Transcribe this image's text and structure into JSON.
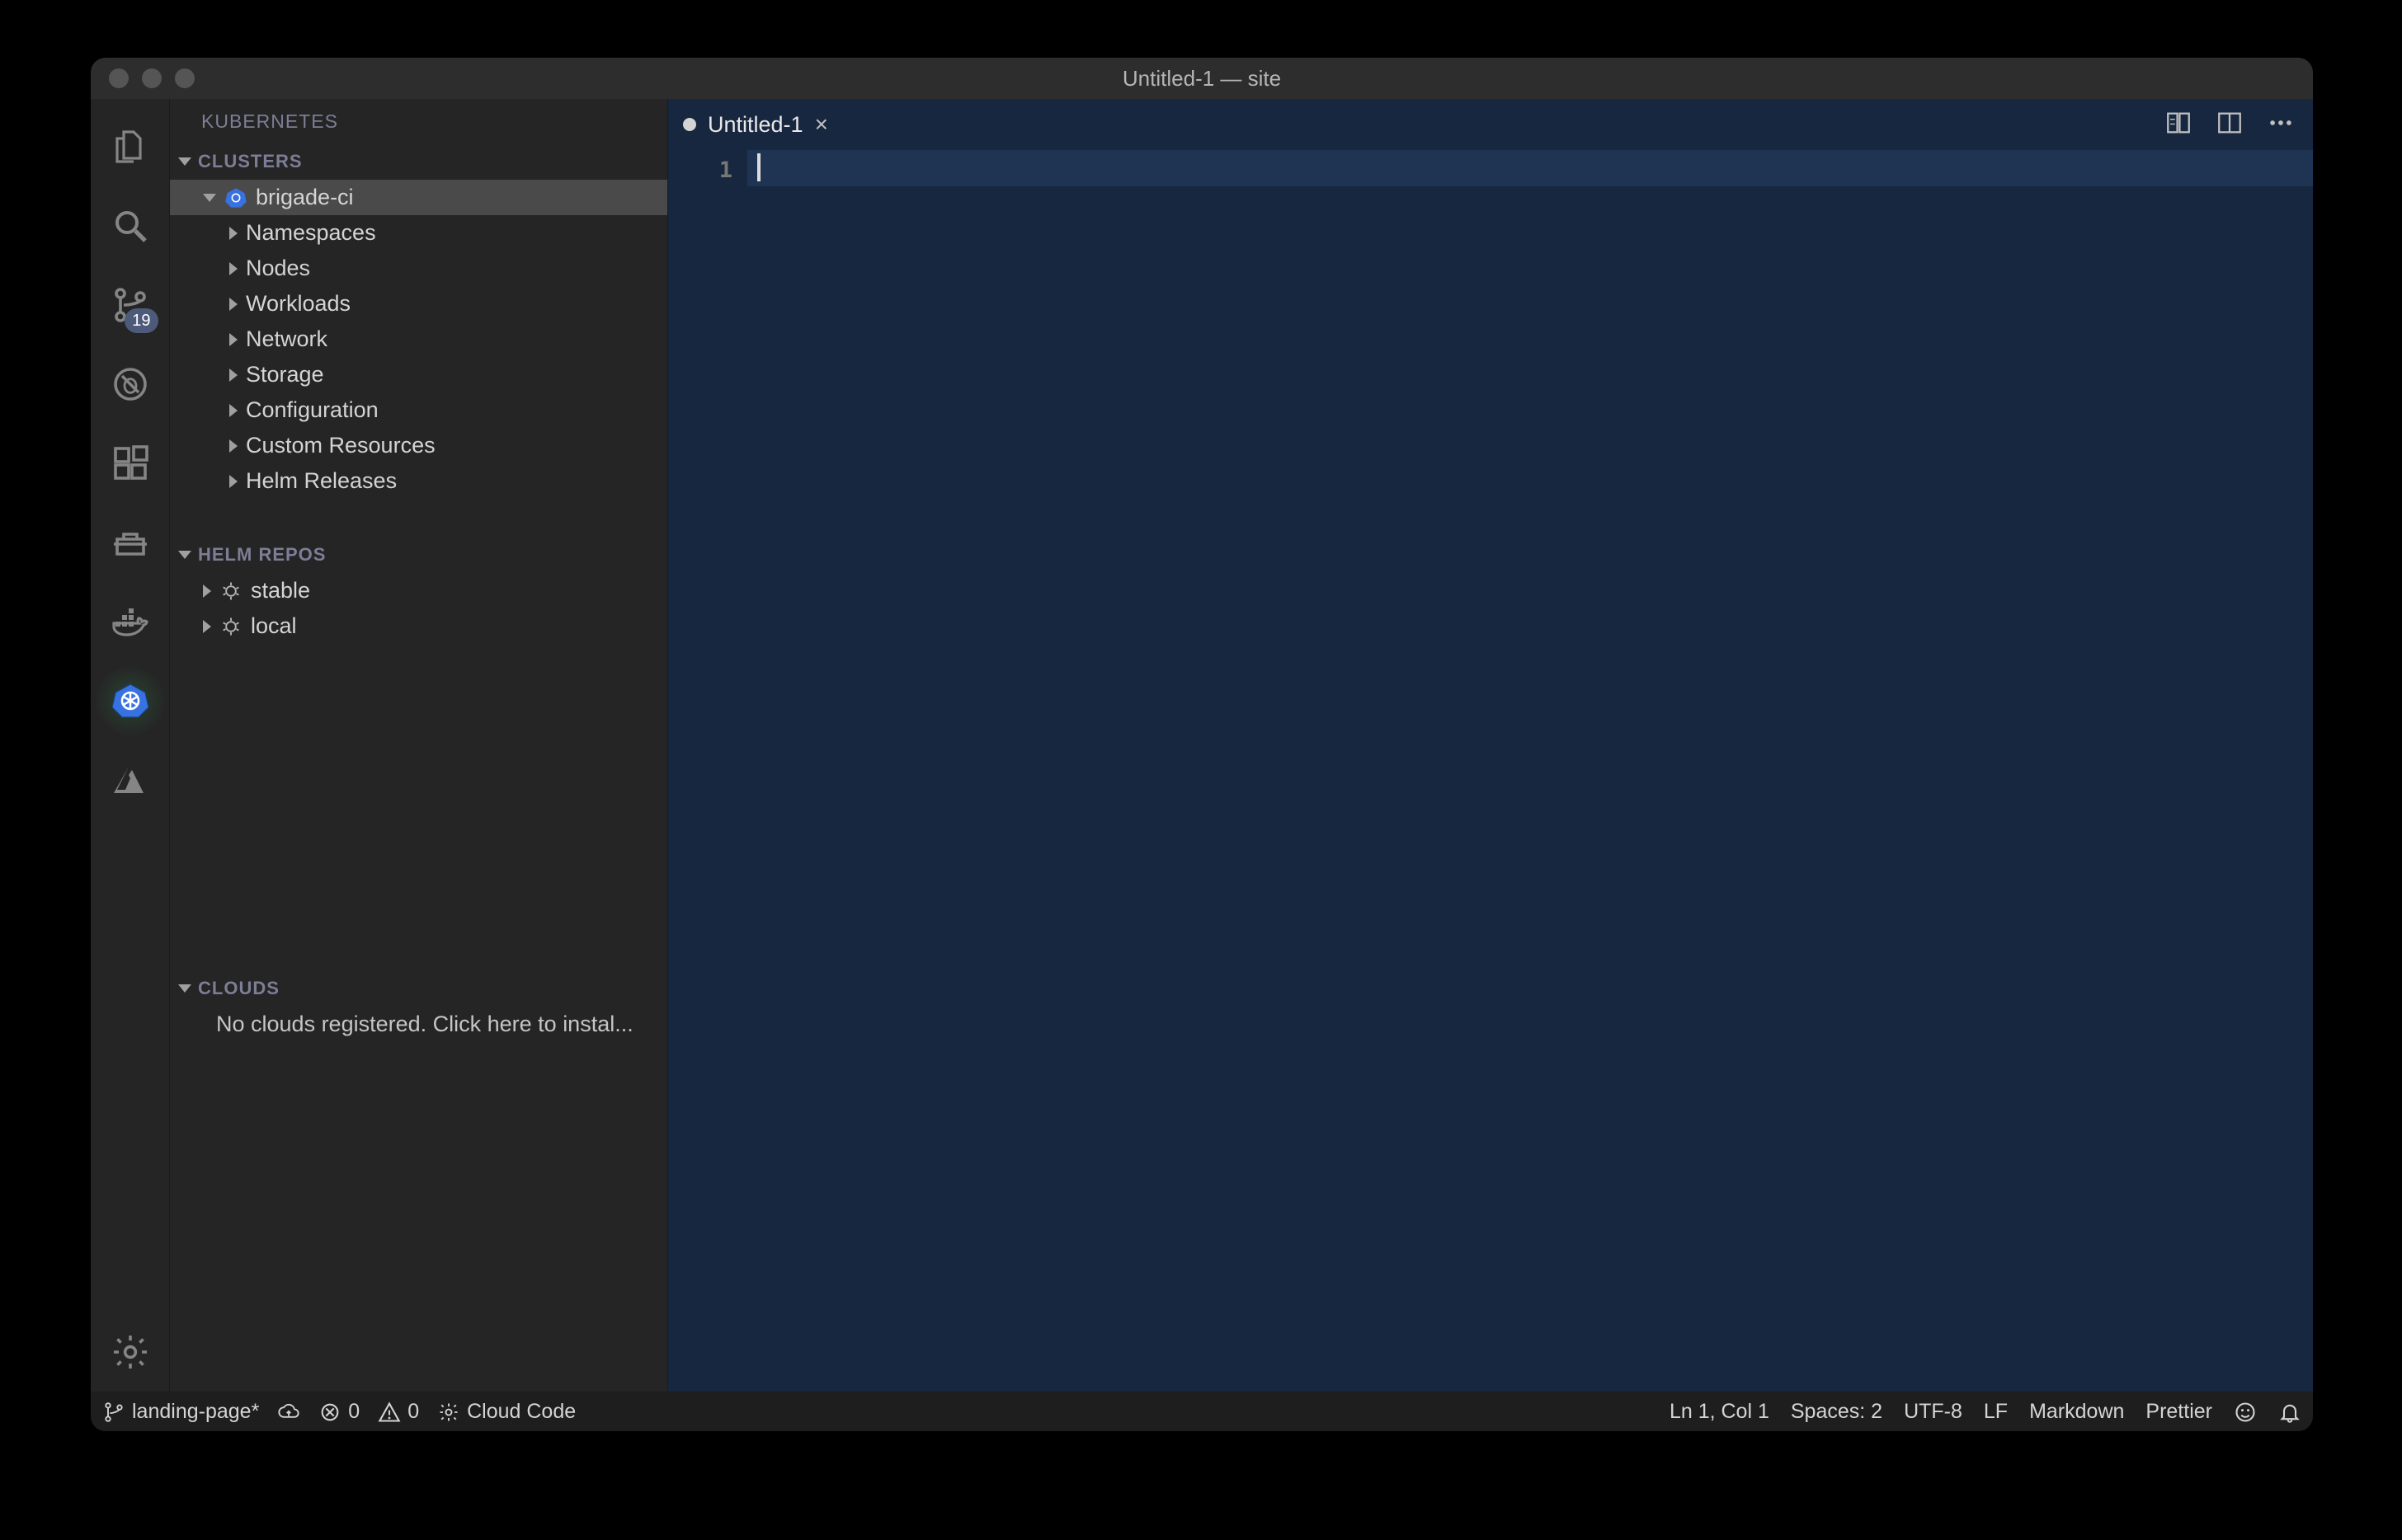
{
  "title": "Untitled-1 — site",
  "sidebar": {
    "heading": "KUBERNETES",
    "sections": {
      "clusters": {
        "label": "CLUSTERS",
        "cluster": "brigade-ci",
        "items": [
          "Namespaces",
          "Nodes",
          "Workloads",
          "Network",
          "Storage",
          "Configuration",
          "Custom Resources",
          "Helm Releases"
        ]
      },
      "helm": {
        "label": "HELM REPOS",
        "items": [
          "stable",
          "local"
        ]
      },
      "clouds": {
        "label": "CLOUDS",
        "empty": "No clouds registered. Click here to instal..."
      }
    }
  },
  "activitybar": {
    "badge": "19"
  },
  "tabs": {
    "0": {
      "label": "Untitled-1"
    }
  },
  "editor": {
    "line_number": "1"
  },
  "status": {
    "branch": "landing-page*",
    "errors": "0",
    "warnings": "0",
    "cloud_code": "Cloud Code",
    "cursor": "Ln 1, Col 1",
    "spaces": "Spaces: 2",
    "encoding": "UTF-8",
    "eol": "LF",
    "language": "Markdown",
    "formatter": "Prettier"
  }
}
